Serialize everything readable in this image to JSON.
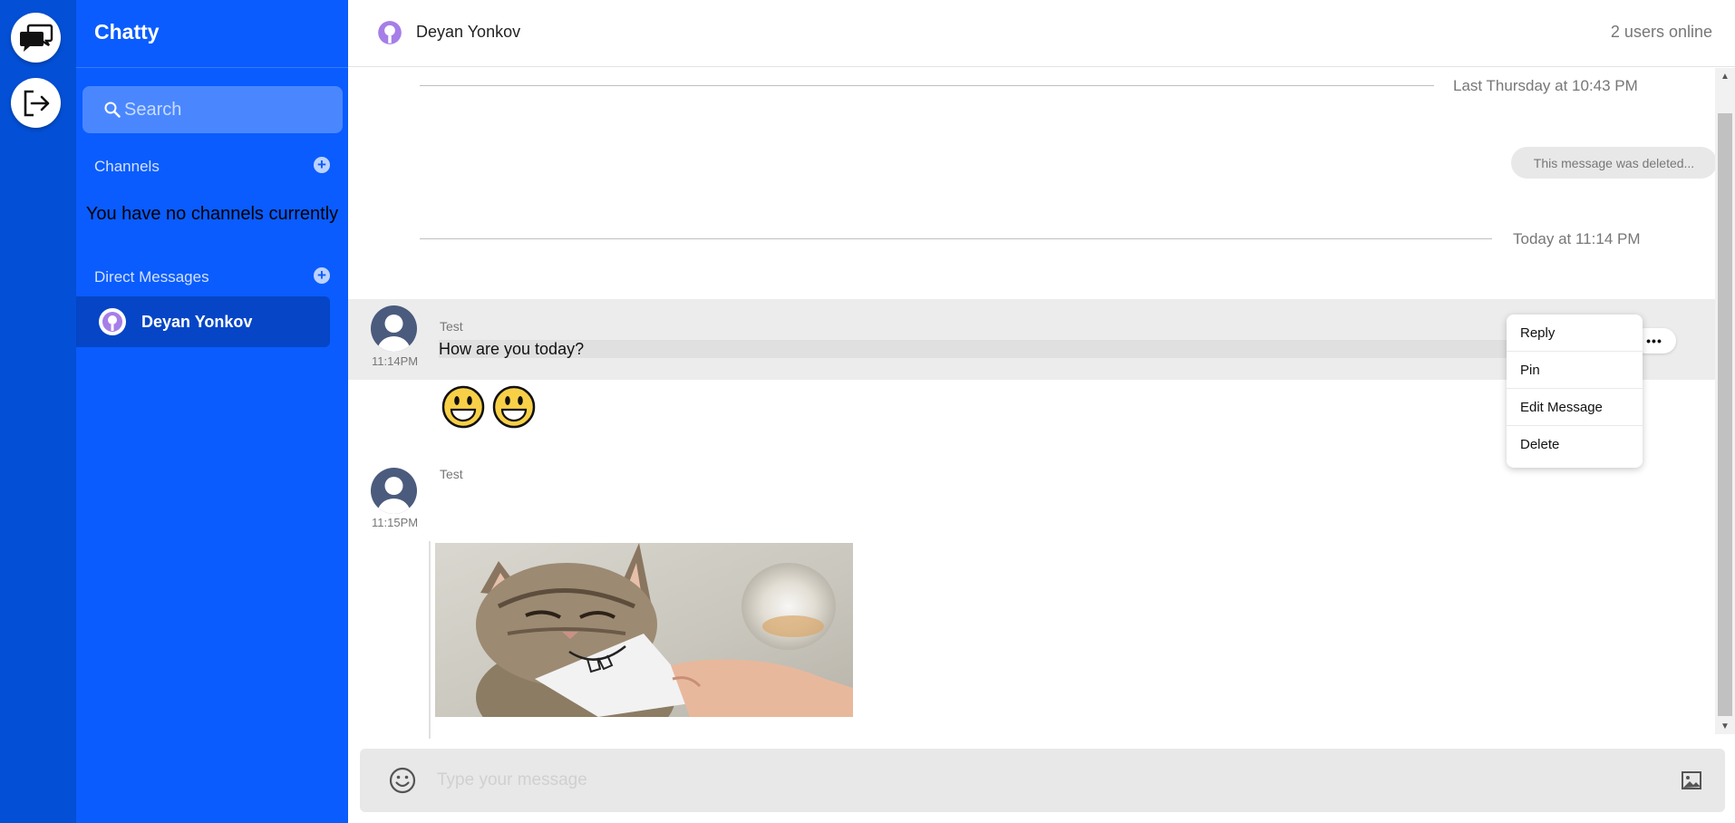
{
  "app": {
    "brand": "Chatty"
  },
  "sidebar": {
    "search_placeholder": "Search",
    "channels_label": "Channels",
    "no_channels_text": "You have no channels currently",
    "direct_messages_label": "Direct Messages",
    "direct_messages": [
      {
        "name": "Deyan Yonkov",
        "selected": true
      }
    ]
  },
  "header": {
    "contact_name": "Deyan Yonkov",
    "online_status": "2 users online"
  },
  "messages": {
    "dividers": [
      "Last Thursday at 10:43 PM",
      "Today at 11:14 PM"
    ],
    "deleted_message_text": "This message was deleted...",
    "items": [
      {
        "author": "Test",
        "time": "11:14PM",
        "text": "How are you today?",
        "emojis": [
          "grinning-face",
          "grinning-face"
        ]
      },
      {
        "author": "Test",
        "time": "11:15PM",
        "attachment": "cat photo"
      }
    ]
  },
  "context_menu": {
    "more_label": "•••",
    "items": [
      "Reply",
      "Pin",
      "Edit Message",
      "Delete"
    ]
  },
  "composer": {
    "placeholder": "Type your message",
    "value": ""
  },
  "colors": {
    "rail": "#0350d6",
    "sidebar": "#0a5cfe",
    "selected_item": "#0545c6",
    "search_box": "#4a87ff",
    "avatar": "#4a5b7d",
    "composer_bg": "#e8e8e8"
  },
  "icons": {
    "rail_chat": "chat-bubbles-icon",
    "rail_logout": "logout-icon",
    "search": "search-icon",
    "add": "plus-circle-icon",
    "user_avatar": "purple-user-avatar-icon",
    "composer_emoji": "smiley-icon",
    "composer_attach": "image-icon"
  }
}
